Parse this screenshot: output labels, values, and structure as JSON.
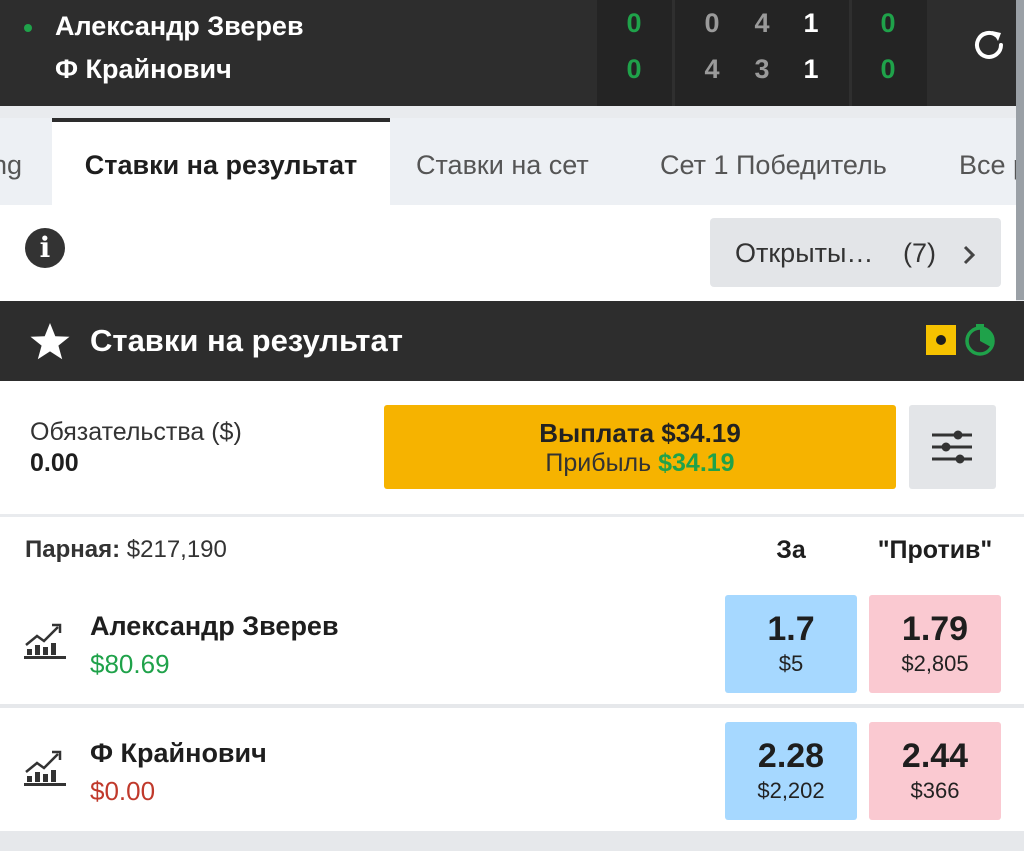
{
  "scoreboard": {
    "player1": "Александр Зверев",
    "player2": "Ф Крайнович",
    "p1_scores": [
      "0",
      "0",
      "4",
      "1",
      "0"
    ],
    "p2_scores": [
      "0",
      "4",
      "3",
      "1",
      "0"
    ],
    "refresh_icon": "refresh-icon"
  },
  "tabs": [
    {
      "label": "ng"
    },
    {
      "label": "Ставки на результат"
    },
    {
      "label": "Ставки на сет"
    },
    {
      "label": "Сет 1 Победитель"
    },
    {
      "label": "Все р"
    }
  ],
  "info_row": {
    "info_icon": "i",
    "open_bets_label": "Открыты…",
    "open_bets_count": "(7)"
  },
  "market": {
    "title": "Ставки на результат",
    "star_icon": "star-icon"
  },
  "liability": {
    "label": "Обязательства ($)",
    "value": "0.00"
  },
  "payout": {
    "payout_text": "Выплата $34.19",
    "profit_label": "Прибыль ",
    "profit_value": "$34.19"
  },
  "matched": {
    "label": "Парная:",
    "value": " $217,190"
  },
  "columns": {
    "back": "За",
    "lay": "\"Против\""
  },
  "runners": [
    {
      "name": "Александр Зверев",
      "pl": "$80.69",
      "back_price": "1.7",
      "back_size": "$5",
      "lay_price": "1.79",
      "lay_size": "$2,805"
    },
    {
      "name": "Ф Крайнович",
      "pl": "$0.00",
      "back_price": "2.28",
      "back_size": "$2,202",
      "lay_price": "2.44",
      "lay_size": "$366"
    }
  ],
  "colors": {
    "green": "#1fa24a",
    "yellow": "#f6b300",
    "back_blue": "#a6d8ff",
    "lay_pink": "#fac9d1",
    "dark": "#2d2d2d"
  }
}
